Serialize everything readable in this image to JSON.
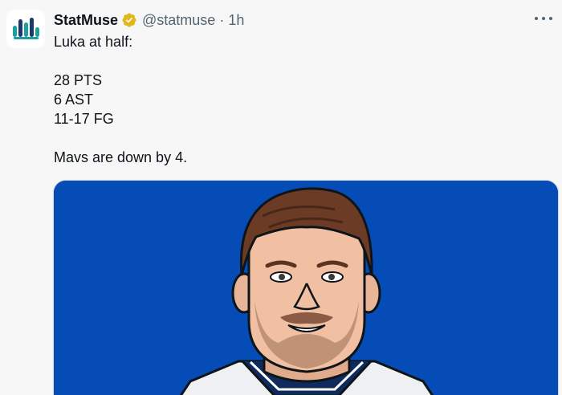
{
  "tweet": {
    "display_name": "StatMuse",
    "handle": "@statmuse",
    "separator": "·",
    "time": "1h",
    "lines": [
      "Luka at half:",
      "28 PTS",
      "6 AST",
      "11-17 FG",
      "Mavs are down by 4."
    ],
    "avatar_icon": "statmuse-logo-icon",
    "verified_icon": "verified-badge-icon",
    "more_icon": "more-options-icon"
  },
  "media": {
    "background_color": "#054cb7",
    "subject": "player-illustration"
  },
  "colors": {
    "text_primary": "#0f1419",
    "text_secondary": "#536471",
    "verified_gold": "#e2b719",
    "logo_teal": "#1da09c",
    "logo_navy": "#1b3a6b"
  }
}
